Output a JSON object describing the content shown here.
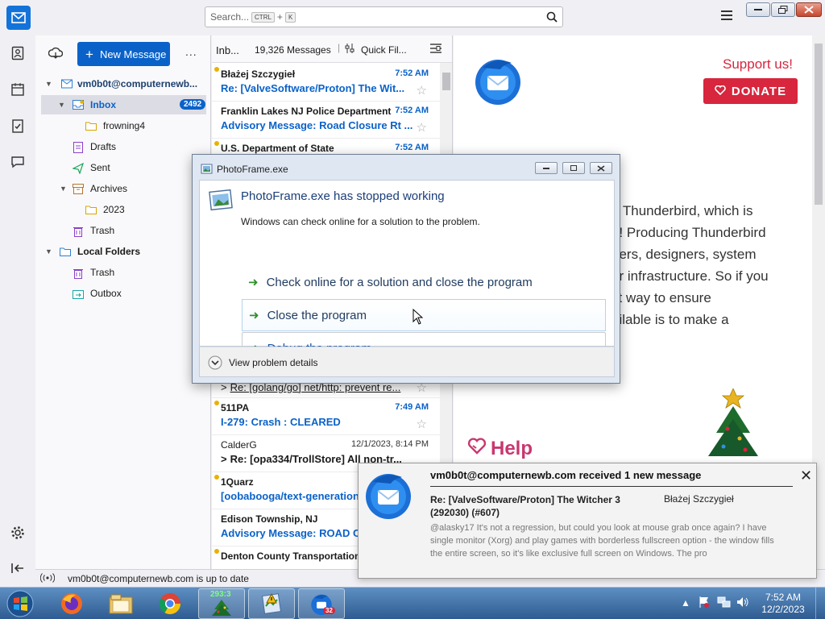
{
  "search": {
    "placeholder": "Search...",
    "key1": "CTRL",
    "plus": "+",
    "key2": "K"
  },
  "folder_pane": {
    "new_message": "New Message",
    "more": "...",
    "account": "vm0b0t@computernewb...",
    "inbox": "Inbox",
    "inbox_count": "2492",
    "folders": {
      "frowning4": "frowning4",
      "drafts": "Drafts",
      "sent": "Sent",
      "archives": "Archives",
      "year2023": "2023",
      "trash": "Trash",
      "local_folders": "Local Folders",
      "local_trash": "Trash",
      "outbox": "Outbox"
    }
  },
  "thread_pane": {
    "folder": "Inb...",
    "count": "19,326 Messages",
    "quick_filter": "Quick Fil...",
    "messages": [
      {
        "sender": "Błażej Szczygieł",
        "time": "7:52 AM",
        "subject": "Re: [ValveSoftware/Proton] The Wit..."
      },
      {
        "sender": "Franklin Lakes NJ Police Department",
        "time": "7:52 AM",
        "subject": "Advisory Message: Road Closure Rt ..."
      },
      {
        "sender": "U.S. Department of State",
        "time": "7:52 AM",
        "subject": ""
      },
      {
        "sender": "",
        "time": "",
        "subject": "Re: [golang/go] net/http: prevent re..."
      },
      {
        "sender": "511PA",
        "time": "7:49 AM",
        "subject": "I-279: Crash : CLEARED"
      },
      {
        "sender": "CalderG",
        "time": "12/1/2023, 8:14 PM",
        "subject": "Re: [opa334/TrollStore] All non-tr..."
      },
      {
        "sender": "1Quarz",
        "time": "",
        "subject": "[oobabooga/text-generation-webui]"
      },
      {
        "sender": "Edison Township, NJ",
        "time": "",
        "subject": "Advisory Message: ROAD C..."
      },
      {
        "sender": "Denton County Transportation",
        "time": "",
        "subject": ""
      }
    ]
  },
  "message_pane": {
    "support": "Support us!",
    "donate": "DONATE",
    "body_lines": [
      "g Thunderbird, which is",
      "u! Producing Thunderbird",
      "eers, designers, system",
      "er infrastructure. So if you",
      "st way to ensure",
      "ailable is to make a"
    ],
    "help": "Help"
  },
  "status_bar": {
    "text": "vm0b0t@computernewb.com is up to date"
  },
  "crash_dialog": {
    "title": "PhotoFrame.exe",
    "heading": "PhotoFrame.exe has stopped working",
    "subtext": "Windows can check online for a solution to the problem.",
    "option1": "Check online for a solution and close the program",
    "option2": "Close the program",
    "option3": "Debug the program",
    "details": "View problem details"
  },
  "notification": {
    "title": "vm0b0t@computernewb.com received 1 new message",
    "subject": "Re: [ValveSoftware/Proton] The Witcher 3 (292030) (#607)",
    "from": "Błażej Szczygieł",
    "preview": "@alasky17 It's not a regression, but could you look at mouse grab once again? I have single monitor (Xorg) and play games with borderless fullscreen option - the window fills the entire screen, so it's like exclusive full screen on Windows. The pro"
  },
  "taskbar": {
    "tree_counter": "293:3",
    "tb_badge": "32",
    "time": "7:52 AM",
    "date": "12/2/2023"
  },
  "colors": {
    "accent": "#0a62c9",
    "donate": "#d7263d",
    "unread_dot": "#e9b200"
  }
}
